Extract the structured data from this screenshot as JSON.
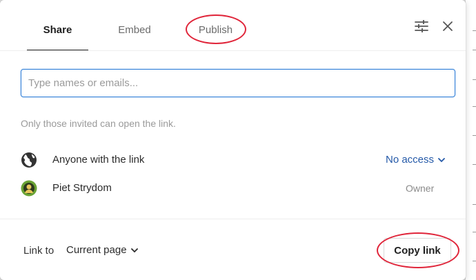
{
  "tabs": [
    {
      "label": "Share",
      "active": true
    },
    {
      "label": "Embed",
      "active": false
    },
    {
      "label": "Publish",
      "active": false,
      "highlighted": true
    }
  ],
  "header": {
    "settings_icon": "sliders-icon",
    "close_icon": "close-icon"
  },
  "invite": {
    "placeholder": "Type names or emails...",
    "value": ""
  },
  "hint": "Only those invited can open the link.",
  "access_rows": [
    {
      "icon": "globe-icon",
      "label": "Anyone with the link",
      "access": "No access"
    },
    {
      "icon": "avatar-icon",
      "label": "Piet Strydom",
      "role": "Owner"
    }
  ],
  "footer": {
    "link_to_label": "Link to",
    "page_select": "Current page",
    "copy_button": "Copy link",
    "copy_button_highlighted": true
  },
  "colors": {
    "accent": "#2f7ed8",
    "access_link": "#2459a8",
    "annotation": "#e0253a"
  }
}
